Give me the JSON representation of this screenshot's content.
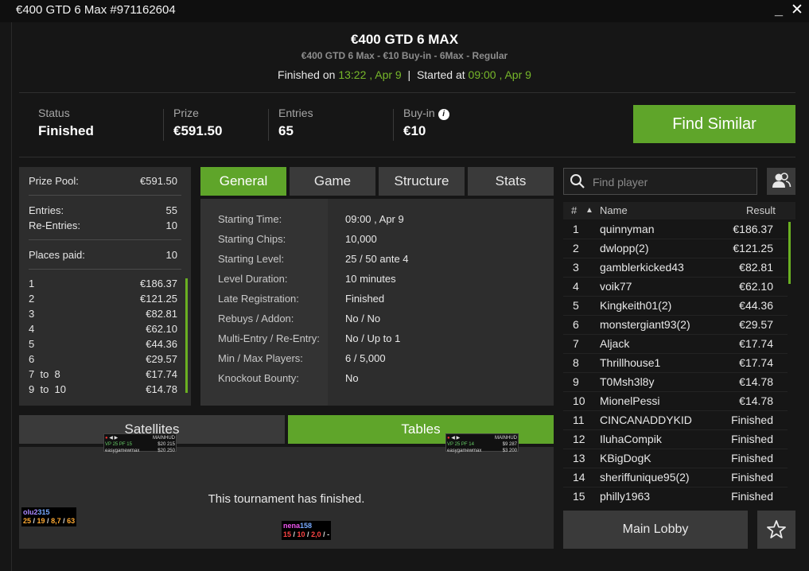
{
  "window": {
    "title": "€400 GTD 6 Max #971162604",
    "minimize": "_",
    "close": "✕"
  },
  "header": {
    "title": "€400 GTD 6 MAX",
    "subtitle": "€400 GTD 6 Max - €10 Buy-in - 6Max - Regular",
    "finished_prefix": "Finished on",
    "finished_at": "13:22 , Apr 9",
    "sep": "|",
    "started_prefix": "Started at",
    "started_at": "09:00 , Apr 9"
  },
  "info": {
    "status_label": "Status",
    "status_value": "Finished",
    "prize_label": "Prize",
    "prize_value": "€591.50",
    "entries_label": "Entries",
    "entries_value": "65",
    "buyin_label": "Buy-in",
    "buyin_value": "€10",
    "info_icon": "i",
    "find_similar": "Find Similar"
  },
  "prize_panel": {
    "prize_pool_label": "Prize Pool:",
    "prize_pool_value": "€591.50",
    "entries_label": "Entries:",
    "entries_value": "55",
    "reentries_label": "Re-Entries:",
    "reentries_value": "10",
    "places_paid_label": "Places paid:",
    "places_paid_value": "10",
    "payouts": [
      {
        "place": "1",
        "amount": "€186.37"
      },
      {
        "place": "2",
        "amount": "€121.25"
      },
      {
        "place": "3",
        "amount": "€82.81"
      },
      {
        "place": "4",
        "amount": "€62.10"
      },
      {
        "place": "5",
        "amount": "€44.36"
      },
      {
        "place": "6",
        "amount": "€29.57"
      },
      {
        "place": "7  to  8",
        "amount": "€17.74"
      },
      {
        "place": "9  to  10",
        "amount": "€14.78"
      }
    ]
  },
  "tabs": [
    "General",
    "Game",
    "Structure",
    "Stats"
  ],
  "general": [
    {
      "label": "Starting Time:",
      "value": "09:00 , Apr 9"
    },
    {
      "label": "Starting Chips:",
      "value": "10,000"
    },
    {
      "label": "Starting Level:",
      "value": "25 / 50 ante 4"
    },
    {
      "label": "Level Duration:",
      "value": "10 minutes"
    },
    {
      "label": "Late Registration:",
      "value": "Finished"
    },
    {
      "label": "Rebuys / Addon:",
      "value": "No / No"
    },
    {
      "label": "Multi-Entry / Re-Entry:",
      "value": "No / Up to 1"
    },
    {
      "label": "Min / Max Players:",
      "value": "6 / 5,000"
    },
    {
      "label": "Knockout Bounty:",
      "value": "No"
    }
  ],
  "bottom": {
    "satellites_tab": "Satellites",
    "tables_tab": "Tables",
    "message": "This tournament has finished."
  },
  "hud": {
    "hud1": {
      "label": "MAINHUD",
      "row1a": "VP 25",
      "row1b": "PF 15",
      "row1c": "$20 215",
      "row2a": "easygamewmax",
      "row2b": "$20 250"
    },
    "hud2": {
      "label": "MAINHUD",
      "row1a": "VP 25",
      "row1b": "PF 14",
      "row1c": "$9 287",
      "row2a": "easygamewmax",
      "row2b": "$3 200"
    },
    "stat1": {
      "name": "olu2",
      "num": "315",
      "s1": "25",
      "s2": "19",
      "s3": "8,7",
      "s4": "63"
    },
    "stat2": {
      "name": "nena",
      "num": "158",
      "s1": "15",
      "s2": "10",
      "s3": "2,0",
      "s4": "-"
    }
  },
  "players": {
    "search_placeholder": "Find player",
    "col_rank": "#",
    "sort_arrow": "▲",
    "col_name": "Name",
    "col_result": "Result",
    "rows": [
      {
        "rank": "1",
        "name": "quinnyman",
        "result": "€186.37"
      },
      {
        "rank": "2",
        "name": "dwlopp(2)",
        "result": "€121.25"
      },
      {
        "rank": "3",
        "name": "gamblerkicked43",
        "result": "€82.81"
      },
      {
        "rank": "4",
        "name": "voik77",
        "result": "€62.10"
      },
      {
        "rank": "5",
        "name": "Kingkeith01(2)",
        "result": "€44.36"
      },
      {
        "rank": "6",
        "name": "monstergiant93(2)",
        "result": "€29.57"
      },
      {
        "rank": "7",
        "name": "Aljack",
        "result": "€17.74"
      },
      {
        "rank": "8",
        "name": "Thrillhouse1",
        "result": "€17.74"
      },
      {
        "rank": "9",
        "name": "T0Msh3l8y",
        "result": "€14.78"
      },
      {
        "rank": "10",
        "name": "MionelPessi",
        "result": "€14.78"
      },
      {
        "rank": "11",
        "name": "CINCANADDYKID",
        "result": "Finished"
      },
      {
        "rank": "12",
        "name": "IluhaCompik",
        "result": "Finished"
      },
      {
        "rank": "13",
        "name": "KBigDogK",
        "result": "Finished"
      },
      {
        "rank": "14",
        "name": "sheriffunique95(2)",
        "result": "Finished"
      },
      {
        "rank": "15",
        "name": "philly1963",
        "result": "Finished"
      }
    ],
    "main_lobby": "Main Lobby"
  },
  "colors": {
    "accent": "#5fa52a",
    "background": "#161616",
    "panel": "#2d2d2d"
  }
}
